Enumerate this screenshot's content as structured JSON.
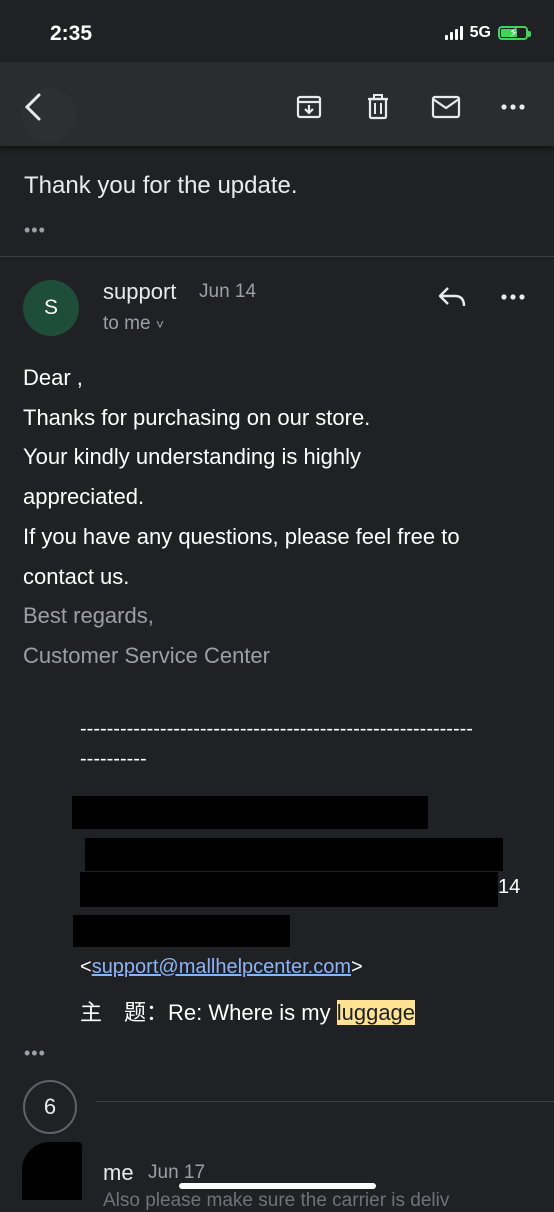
{
  "status_bar": {
    "time": "2:35",
    "network": "5G"
  },
  "toolbar": {
    "icons": [
      "back-arrow-icon",
      "archive-icon",
      "trash-icon",
      "mail-icon",
      "more-icon"
    ]
  },
  "previous_message": {
    "text": "Thank you for the update.",
    "expand": "•••"
  },
  "message": {
    "avatar_letter": "S",
    "sender": "support",
    "date": "Jun 14",
    "recipient": "to me",
    "chevron": "˅",
    "body": {
      "greeting": "Dear ,",
      "line1": "Thanks for purchasing on our store.",
      "line2": "Your kindly understanding is highly appreciated.",
      "line3": "If you have any questions, please feel free to contact us.",
      "closing": "Best regards,",
      "signature": "Customer Service Center"
    },
    "quoted": {
      "separator_line1": "-----------------------------------------------------------",
      "separator_line2": "----------",
      "date_tail": "14",
      "email_open": "<",
      "email": "support@mallhelpcenter.com",
      "email_close": ">",
      "subject_label": "主　题：",
      "subject_prefix": "Re: Where is my ",
      "subject_highlight": "luggage"
    },
    "expand": "•••"
  },
  "thread": {
    "hidden_count": "6",
    "next_sender": "me",
    "next_date": "Jun 17",
    "next_snippet": "Also please make sure the carrier is deliv"
  }
}
